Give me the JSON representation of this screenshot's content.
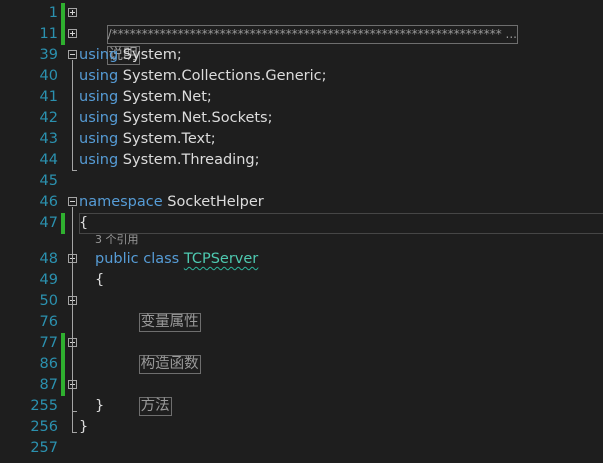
{
  "editor": {
    "language": "C#",
    "colors": {
      "background": "#1e1e1e",
      "line_number": "#2b91af",
      "keyword": "#569cd6",
      "type": "#4ec9b0",
      "text": "#dcdcdc",
      "change_bar": "#57a64a"
    },
    "lines": [
      {
        "number": "1",
        "text": "/*****************************************************************",
        "ellipsis": "...",
        "fold": "plus",
        "changed": true
      },
      {
        "number": "11",
        "text": "说明",
        "fold": "plus",
        "changed": true
      },
      {
        "number": "39",
        "keyword": "using",
        "rest": " System;",
        "fold": "minus"
      },
      {
        "number": "40",
        "keyword": "using",
        "rest": " System.Collections.Generic;"
      },
      {
        "number": "41",
        "keyword": "using",
        "rest": " System.Net;"
      },
      {
        "number": "42",
        "keyword": "using",
        "rest": " System.Net.Sockets;"
      },
      {
        "number": "43",
        "keyword": "using",
        "rest": " System.Text;"
      },
      {
        "number": "44",
        "keyword": "using",
        "rest": " System.Threading;"
      },
      {
        "number": "45",
        "text": ""
      },
      {
        "number": "46",
        "keyword": "namespace",
        "rest": " SocketHelper",
        "fold": "minus"
      },
      {
        "number": "47",
        "text": "{",
        "changed": true,
        "current": true
      },
      {
        "codelens": "3 个引用"
      },
      {
        "number": "48",
        "keyword": "public class",
        "type_name": "TCPServer",
        "fold": "minus"
      },
      {
        "number": "49",
        "text": "{"
      },
      {
        "number": "50",
        "region": "变量属性",
        "fold": "plus"
      },
      {
        "number": "76",
        "text": ""
      },
      {
        "number": "77",
        "region": "构造函数",
        "fold": "plus",
        "changed": true
      },
      {
        "number": "86",
        "text": "",
        "changed": true
      },
      {
        "number": "87",
        "region": "方法",
        "fold": "plus",
        "changed": true
      },
      {
        "number": "255",
        "text": "}"
      },
      {
        "number": "256",
        "text": "}"
      },
      {
        "number": "257",
        "text": ""
      }
    ]
  }
}
